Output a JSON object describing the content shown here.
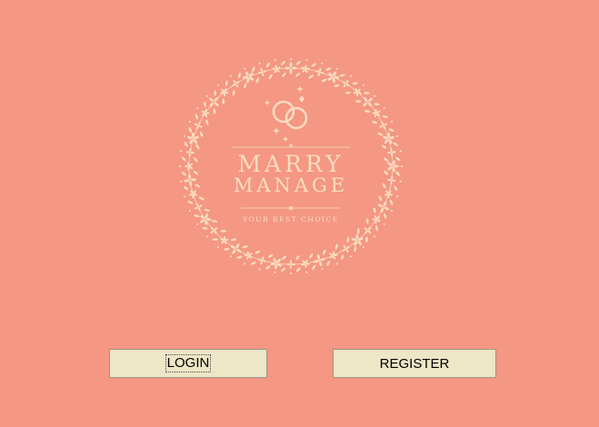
{
  "logo": {
    "icon": "wedding-rings-icon",
    "title_line1": "MARRY",
    "title_line2": "MANAGE",
    "tagline": "YOUR BEST CHOICE"
  },
  "buttons": {
    "login_label": "LOGIN",
    "register_label": "REGISTER"
  },
  "colors": {
    "background": "#f49783",
    "logo_color": "#fbdcc0",
    "button_face": "#ede6c7"
  }
}
